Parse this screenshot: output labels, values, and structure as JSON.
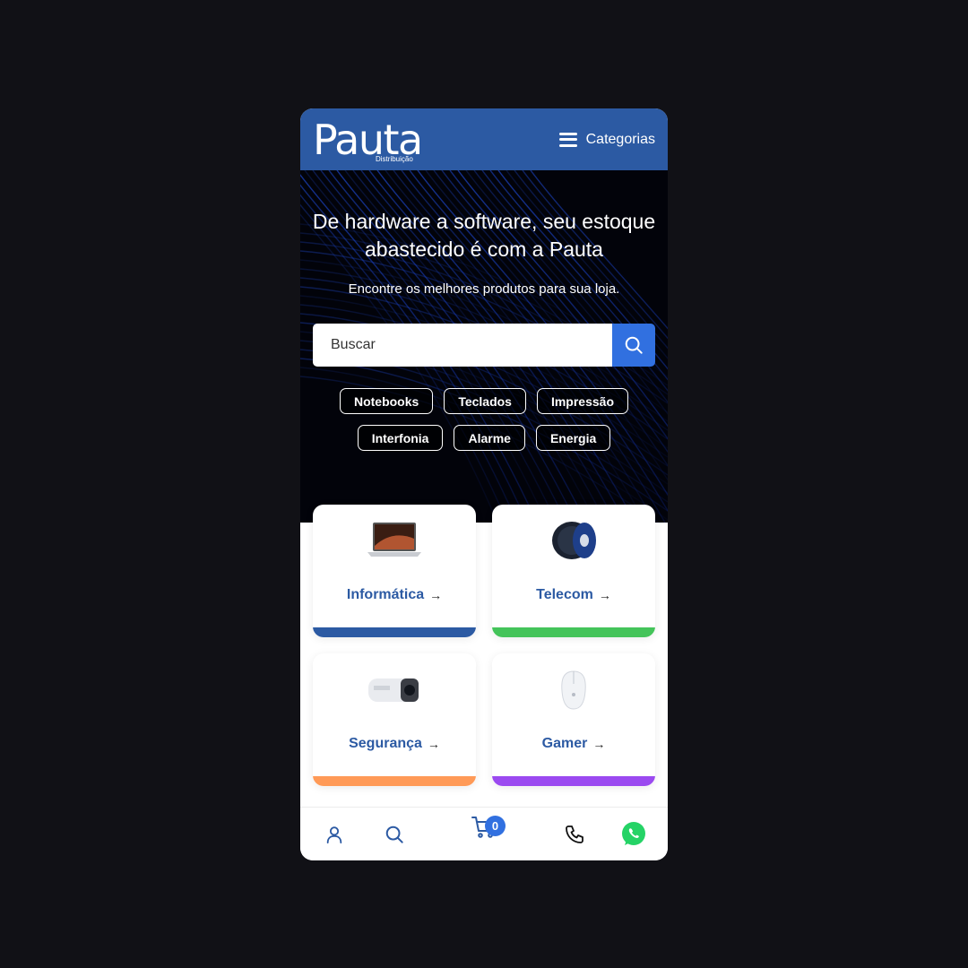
{
  "header": {
    "logo_text": "Pauta",
    "logo_sub": "Distribuição",
    "menu_label": "Categorias",
    "brand_color": "#2c5aa3"
  },
  "hero": {
    "title": "De hardware a software, seu estoque abastecido é com a Pauta",
    "subtitle": "Encontre os melhores produtos para sua loja.",
    "search_placeholder": "Buscar",
    "search_icon": "search-icon",
    "chips_row1": [
      "Notebooks",
      "Teclados",
      "Impressão"
    ],
    "chips_row2": [
      "Interfonia",
      "Alarme",
      "Energia"
    ]
  },
  "categories": [
    {
      "label": "Informática",
      "accent": "#2c5aa3",
      "image": "laptop-image"
    },
    {
      "label": "Telecom",
      "accent": "#44c45a",
      "image": "cable-spool-image"
    },
    {
      "label": "Segurança",
      "accent": "#ff9a57",
      "image": "security-camera-image"
    },
    {
      "label": "Gamer",
      "accent": "#9b4af0",
      "image": "gaming-mouse-image"
    }
  ],
  "bottom_nav": {
    "cart_count": "0",
    "items": [
      "user-icon",
      "search-icon",
      "cart-icon",
      "phone-icon",
      "whatsapp-icon"
    ],
    "whatsapp_color": "#25d366",
    "accent": "#3170e0"
  }
}
